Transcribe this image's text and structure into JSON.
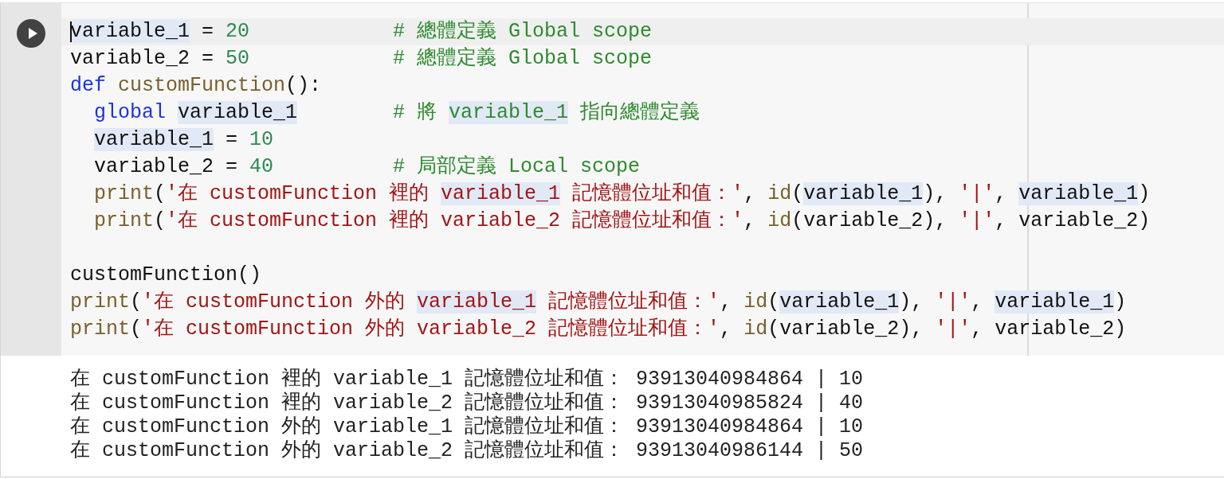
{
  "cell": {
    "code": [
      {
        "kind": "code",
        "cursor": true,
        "tokens": [
          {
            "kind": "plain-match",
            "text": "variable_1"
          },
          {
            "kind": "plain",
            "text": " = "
          },
          {
            "kind": "number",
            "text": "20"
          }
        ],
        "comment": [
          {
            "kind": "comment",
            "text": "# 總體定義 Global scope"
          }
        ]
      },
      {
        "kind": "code",
        "tokens": [
          {
            "kind": "plain",
            "text": "variable_2 = "
          },
          {
            "kind": "number",
            "text": "50"
          }
        ],
        "comment": [
          {
            "kind": "comment",
            "text": "# 總體定義 Global scope"
          }
        ]
      },
      {
        "kind": "code",
        "tokens": [
          {
            "kind": "keyword",
            "text": "def "
          },
          {
            "kind": "funcname",
            "text": "customFunction"
          },
          {
            "kind": "plain",
            "text": "():"
          }
        ]
      },
      {
        "kind": "code",
        "indent": true,
        "tokens": [
          {
            "kind": "keyword",
            "text": "global "
          },
          {
            "kind": "plain-match",
            "text": "variable_1"
          }
        ],
        "comment": [
          {
            "kind": "comment",
            "text": "# 將 "
          },
          {
            "kind": "comment-match",
            "text": "variable_1"
          },
          {
            "kind": "comment",
            "text": " 指向總體定義"
          }
        ]
      },
      {
        "kind": "code",
        "indent": true,
        "tokens": [
          {
            "kind": "plain-match",
            "text": "variable_1"
          },
          {
            "kind": "plain",
            "text": " = "
          },
          {
            "kind": "number",
            "text": "10"
          }
        ]
      },
      {
        "kind": "code",
        "indent": true,
        "tokens": [
          {
            "kind": "plain",
            "text": "variable_2 = "
          },
          {
            "kind": "number",
            "text": "40"
          }
        ],
        "comment": [
          {
            "kind": "comment",
            "text": "# 局部定義 Local scope"
          }
        ]
      },
      {
        "kind": "code",
        "indent": true,
        "tokens": [
          {
            "kind": "builtin",
            "text": "print"
          },
          {
            "kind": "plain",
            "text": "("
          },
          {
            "kind": "string",
            "text": "'在 customFunction 裡的 "
          },
          {
            "kind": "string-match",
            "text": "variable_1"
          },
          {
            "kind": "string",
            "text": " 記憶體位址和值：'"
          },
          {
            "kind": "plain",
            "text": ", "
          },
          {
            "kind": "builtin",
            "text": "id"
          },
          {
            "kind": "plain",
            "text": "("
          },
          {
            "kind": "plain-match",
            "text": "variable_1"
          },
          {
            "kind": "plain",
            "text": "), "
          },
          {
            "kind": "string",
            "text": "'|'"
          },
          {
            "kind": "plain",
            "text": ", "
          },
          {
            "kind": "plain-match",
            "text": "variable_1"
          },
          {
            "kind": "plain",
            "text": ")"
          }
        ]
      },
      {
        "kind": "code",
        "indent": true,
        "tokens": [
          {
            "kind": "builtin",
            "text": "print"
          },
          {
            "kind": "plain",
            "text": "("
          },
          {
            "kind": "string",
            "text": "'在 customFunction 裡的 variable_2 記憶體位址和值：'"
          },
          {
            "kind": "plain",
            "text": ", "
          },
          {
            "kind": "builtin",
            "text": "id"
          },
          {
            "kind": "plain",
            "text": "(variable_2), "
          },
          {
            "kind": "string",
            "text": "'|'"
          },
          {
            "kind": "plain",
            "text": ", variable_2)"
          }
        ]
      },
      {
        "kind": "blank"
      },
      {
        "kind": "code",
        "tokens": [
          {
            "kind": "plain",
            "text": "customFunction()"
          }
        ]
      },
      {
        "kind": "code",
        "tokens": [
          {
            "kind": "builtin",
            "text": "print"
          },
          {
            "kind": "plain",
            "text": "("
          },
          {
            "kind": "string",
            "text": "'在 customFunction 外的 "
          },
          {
            "kind": "string-match",
            "text": "variable_1"
          },
          {
            "kind": "string",
            "text": " 記憶體位址和值：'"
          },
          {
            "kind": "plain",
            "text": ", "
          },
          {
            "kind": "builtin",
            "text": "id"
          },
          {
            "kind": "plain",
            "text": "("
          },
          {
            "kind": "plain-match",
            "text": "variable_1"
          },
          {
            "kind": "plain",
            "text": "), "
          },
          {
            "kind": "string",
            "text": "'|'"
          },
          {
            "kind": "plain",
            "text": ", "
          },
          {
            "kind": "plain-match",
            "text": "variable_1"
          },
          {
            "kind": "plain",
            "text": ")"
          }
        ]
      },
      {
        "kind": "code",
        "tokens": [
          {
            "kind": "builtin",
            "text": "print"
          },
          {
            "kind": "plain",
            "text": "("
          },
          {
            "kind": "string",
            "text": "'在 customFunction 外的 variable_2 記憶體位址和值：'"
          },
          {
            "kind": "plain",
            "text": ", "
          },
          {
            "kind": "builtin",
            "text": "id"
          },
          {
            "kind": "plain",
            "text": "(variable_2), "
          },
          {
            "kind": "string",
            "text": "'|'"
          },
          {
            "kind": "plain",
            "text": ", variable_2)"
          }
        ]
      }
    ],
    "output": [
      "在 customFunction 裡的 variable_1 記憶體位址和值： 93913040984864 | 10",
      "在 customFunction 裡的 variable_2 記憶體位址和值： 93913040985824 | 40",
      "在 customFunction 外的 variable_1 記憶體位址和值： 93913040984864 | 10",
      "在 customFunction 外的 variable_2 記憶體位址和值： 93913040986144 | 50"
    ]
  }
}
